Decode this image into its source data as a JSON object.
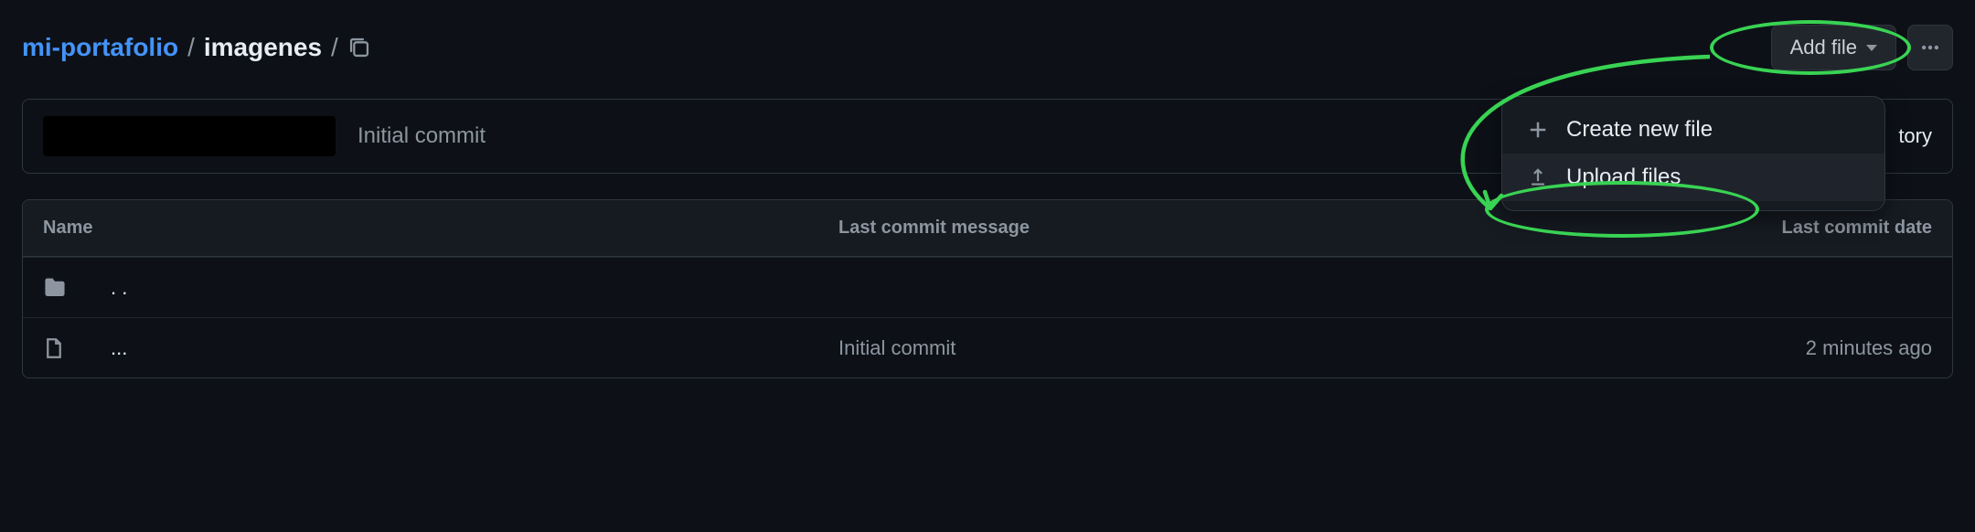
{
  "breadcrumb": {
    "repo": "mi-portafolio",
    "sep": "/",
    "folder": "imagenes",
    "trailing": "/"
  },
  "actions": {
    "add_file": "Add file",
    "menu": {
      "create": "Create new file",
      "upload": "Upload files"
    }
  },
  "commit": {
    "message": "Initial commit",
    "history_suffix": "tory"
  },
  "table": {
    "head_name": "Name",
    "head_msg": "Last commit message",
    "head_date": "Last commit date",
    "rows": [
      {
        "name": ". .",
        "msg": "",
        "date": ""
      },
      {
        "name": "...",
        "msg": "Initial commit",
        "date": "2 minutes ago"
      }
    ]
  }
}
